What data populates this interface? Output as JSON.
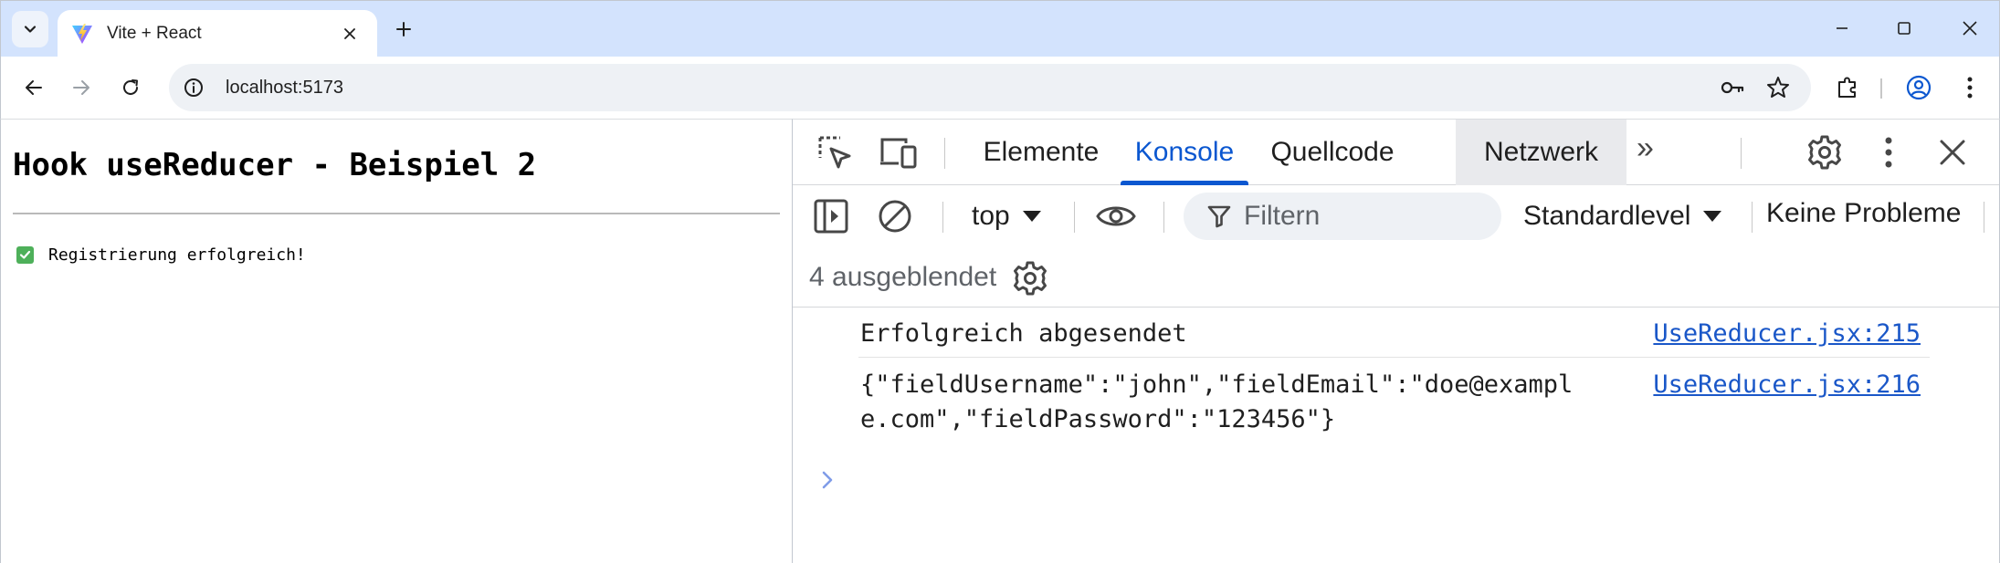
{
  "browser": {
    "tab": {
      "title": "Vite + React"
    },
    "address": {
      "url": "localhost:5173"
    }
  },
  "page": {
    "heading": "Hook useReducer - Beispiel 2",
    "status": {
      "icon": "check-mark-icon",
      "message": "Registrierung erfolgreich!"
    }
  },
  "devtools": {
    "tabs": [
      {
        "label": "Elemente"
      },
      {
        "label": "Konsole",
        "active": true
      },
      {
        "label": "Quellcode"
      },
      {
        "label": "Netzwerk"
      }
    ],
    "more_tabs": "»",
    "filter": {
      "context": "top",
      "placeholder": "Filtern",
      "level": "Standardlevel",
      "issues": "Keine Probleme"
    },
    "hidden_count": "4 ausgeblendet",
    "messages": [
      {
        "lines": [
          "Erfolgreich abgesendet"
        ],
        "source": "UseReducer.jsx:215"
      },
      {
        "lines": [
          "{\"fieldUsername\":\"john\",\"fieldEmail\":\"doe@exampl",
          "e.com\",\"fieldPassword\":\"123456\"}"
        ],
        "source": "UseReducer.jsx:216"
      }
    ]
  },
  "colors": {
    "accent": "#0b57d0",
    "link": "#1a57c8",
    "titlebar": "#d3e3fd",
    "success": "#4eb05a"
  }
}
